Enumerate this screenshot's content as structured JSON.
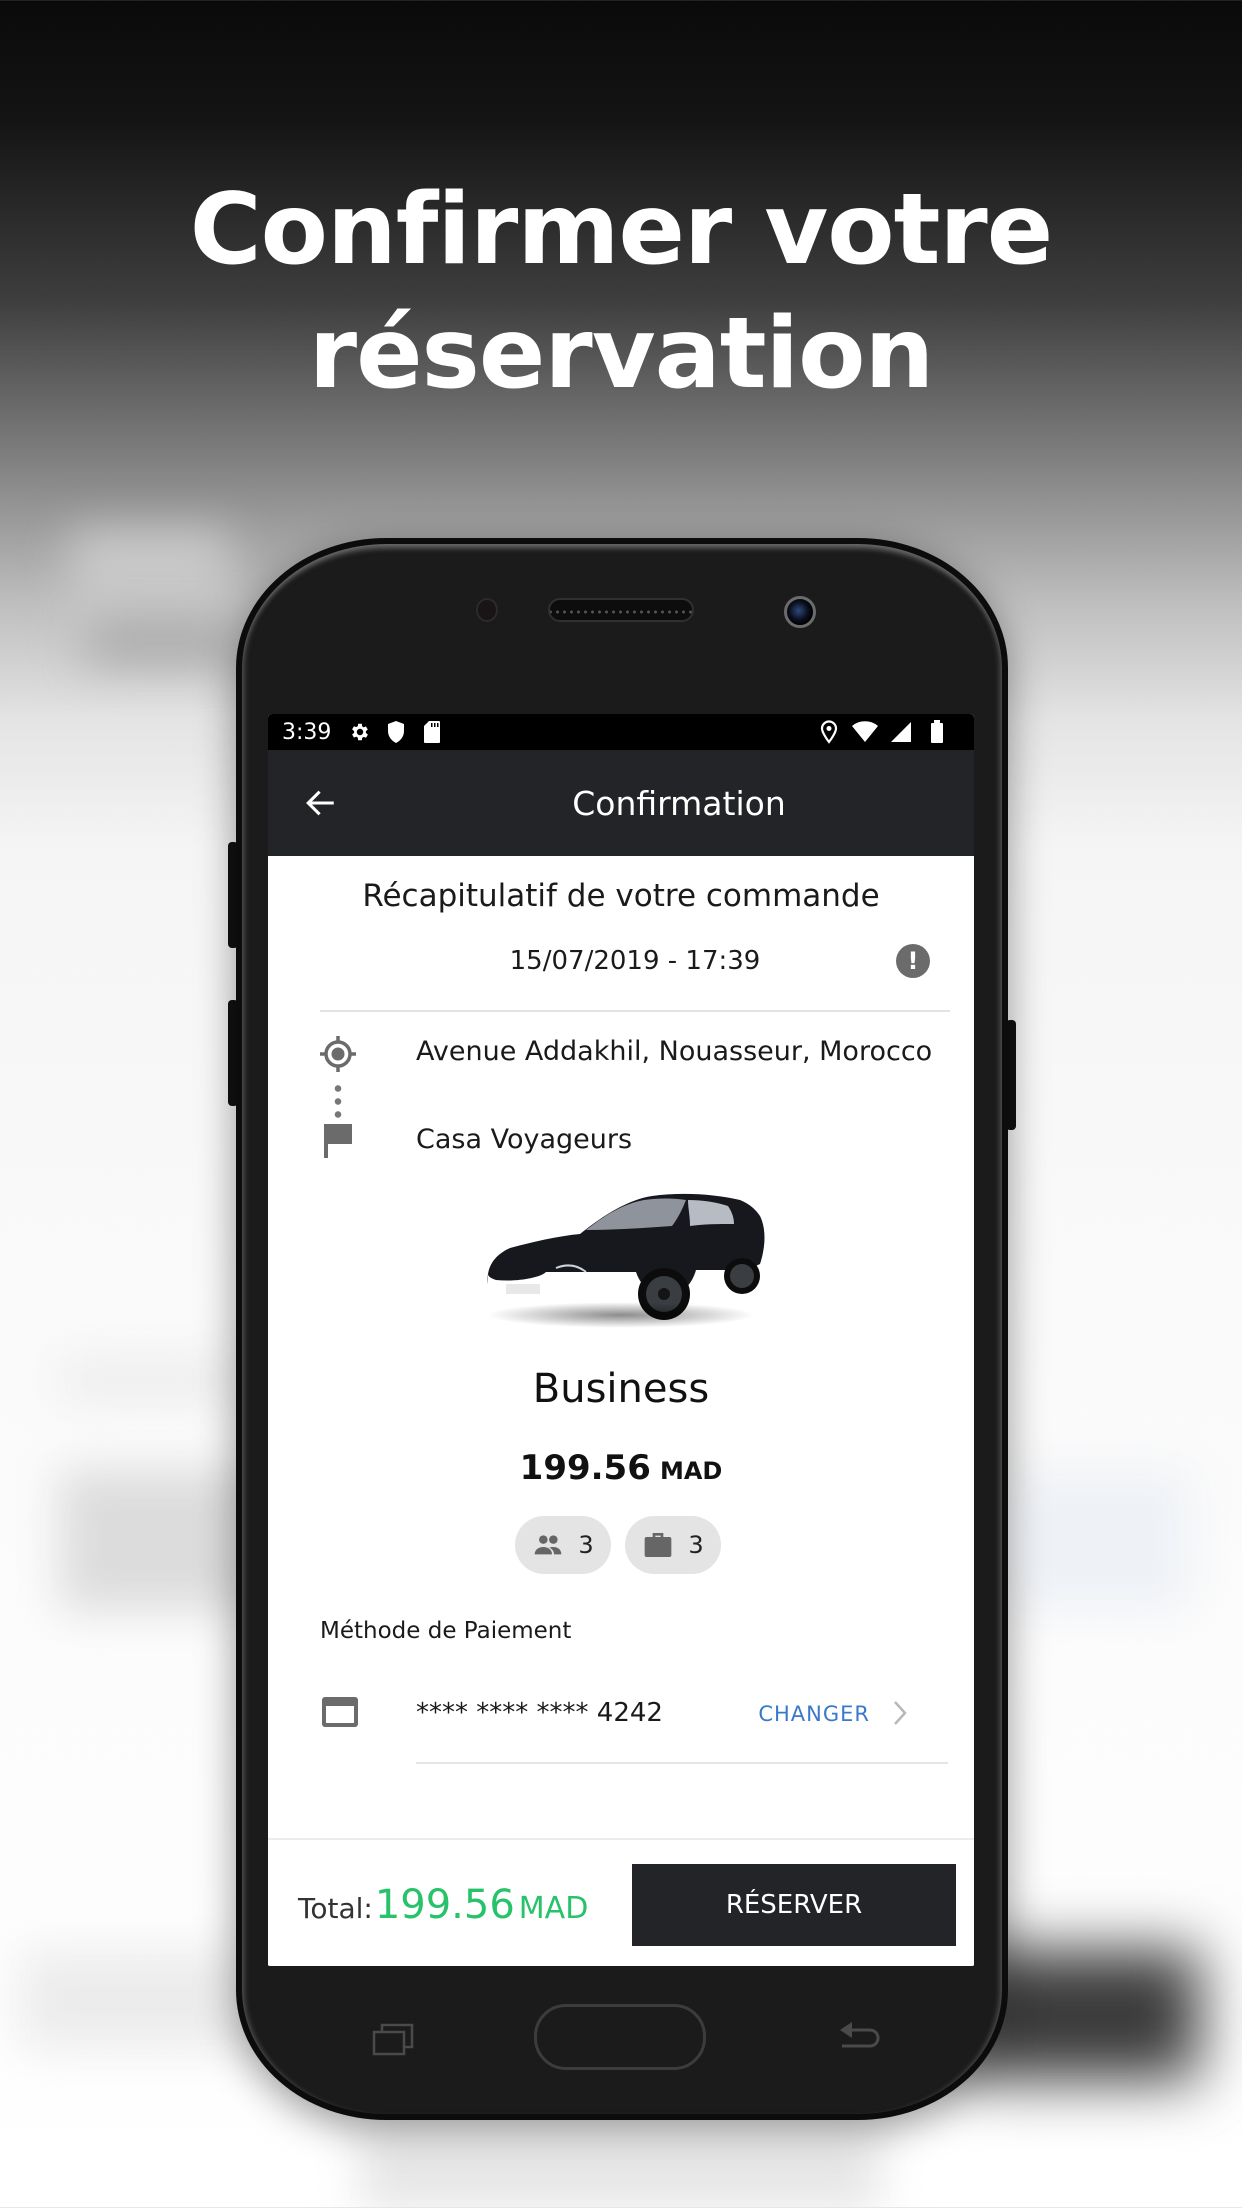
{
  "headline": {
    "line1": "Confirmer votre",
    "line2": "réservation"
  },
  "status_bar": {
    "time": "3:39",
    "left_icons": [
      "gear-icon",
      "shield-icon",
      "sd-card-icon"
    ],
    "right_icons": [
      "location-icon",
      "wifi-icon",
      "signal-icon",
      "battery-icon"
    ]
  },
  "app_bar": {
    "back_icon": "arrow-left-icon",
    "title": "Confirmation"
  },
  "summary": {
    "title": "Récapitulatif de votre commande",
    "datetime": "15/07/2019 - 17:39",
    "info_icon": "!"
  },
  "route": {
    "pickup": "Avenue Addakhil, Nouasseur, Morocco",
    "dropoff": "Casa Voyageurs"
  },
  "vehicle": {
    "category": "Business",
    "price": "199.56",
    "currency": "MAD",
    "passengers": "3",
    "luggage": "3"
  },
  "payment": {
    "label": "Méthode de Paiement",
    "card_number": "**** **** **** 4242",
    "change_label": "CHANGER"
  },
  "footer": {
    "total_label": "Total:",
    "total_value": "199.56",
    "total_currency": "MAD",
    "reserve_label": "RÉSERVER"
  },
  "colors": {
    "app_bar": "#232427",
    "accent_green": "#27c26a",
    "link_blue": "#3a78c9",
    "button_dark": "#232427"
  }
}
